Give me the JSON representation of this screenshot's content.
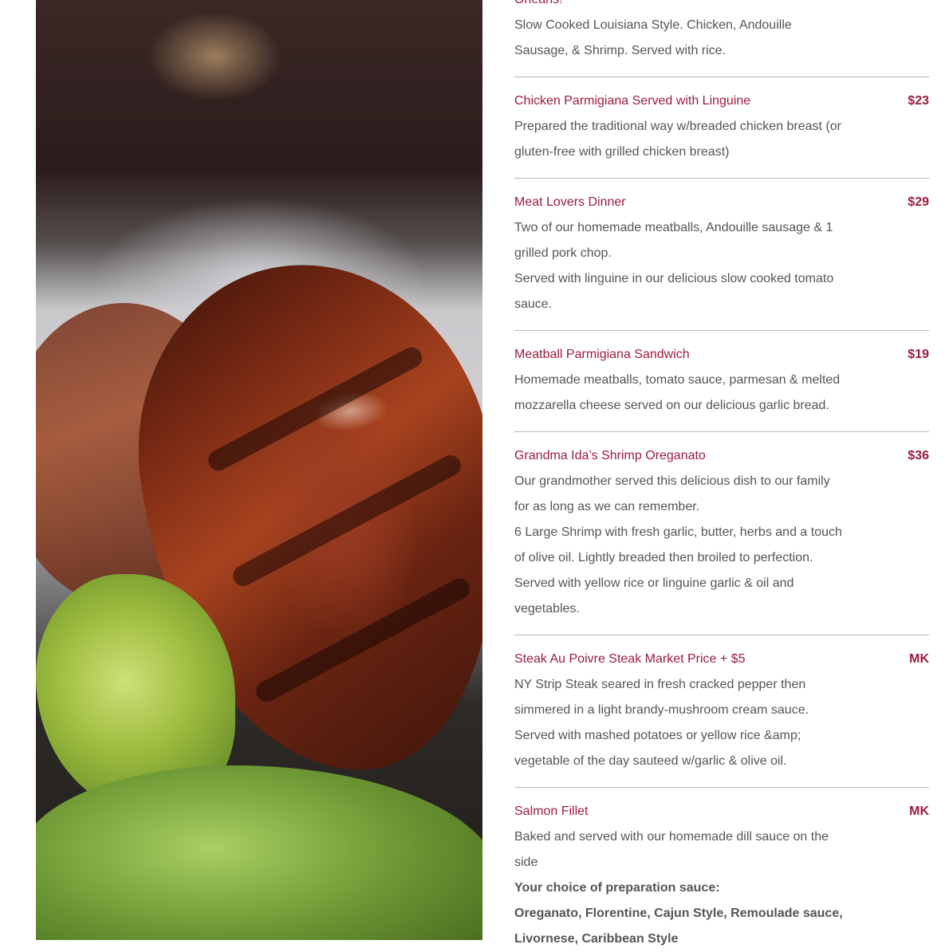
{
  "photo": {
    "alt": "grilled pork chop with sauce, broccoli and greens"
  },
  "menu": {
    "items": [
      {
        "title": "Orleans!",
        "price": "",
        "desc": [
          "Slow Cooked Louisiana Style. Chicken, Andouille",
          "Sausage, & Shrimp. Served with rice."
        ]
      },
      {
        "title": "Chicken Parmigiana Served with Linguine",
        "price": "$23",
        "desc": [
          "Prepared the traditional way w/breaded chicken breast (or",
          "gluten-free with grilled chicken breast)"
        ]
      },
      {
        "title": "Meat Lovers Dinner",
        "price": "$29",
        "desc": [
          "Two of our homemade meatballs, Andouille sausage & 1",
          "grilled pork chop.",
          "Served with linguine in our delicious slow cooked tomato",
          "sauce."
        ]
      },
      {
        "title": "Meatball Parmigiana Sandwich",
        "price": "$19",
        "desc": [
          "Homemade meatballs, tomato sauce, parmesan & melted",
          "mozzarella cheese served on our delicious garlic bread."
        ]
      },
      {
        "title": "Grandma Ida’s Shrimp Oreganato",
        "price": "$36",
        "desc": [
          "Our grandmother served this delicious dish to our family",
          "for as long as we can remember.",
          "6 Large Shrimp with fresh garlic, butter, herbs and a touch",
          "of olive oil. Lightly breaded then broiled to perfection.",
          "Served with yellow rice or linguine garlic & oil and",
          "vegetables."
        ]
      },
      {
        "title": "Steak Au Poivre Steak Market Price + $5",
        "price": "MK",
        "desc": [
          "NY Strip Steak seared in fresh cracked pepper then",
          "simmered in a light brandy-mushroom cream sauce.",
          "Served with mashed potatoes or yellow rice &amp;",
          "vegetable of the day sauteed w/garlic & olive oil."
        ]
      },
      {
        "title": "Salmon Fillet",
        "price": "MK",
        "desc": [
          "Baked and served with our homemade dill sauce on the",
          "side"
        ],
        "bold": [
          "Your choice of preparation sauce:",
          "Oreganato, Florentine, Cajun Style, Remoulade sauce,",
          "Livornese, Caribbean Style"
        ]
      }
    ]
  }
}
